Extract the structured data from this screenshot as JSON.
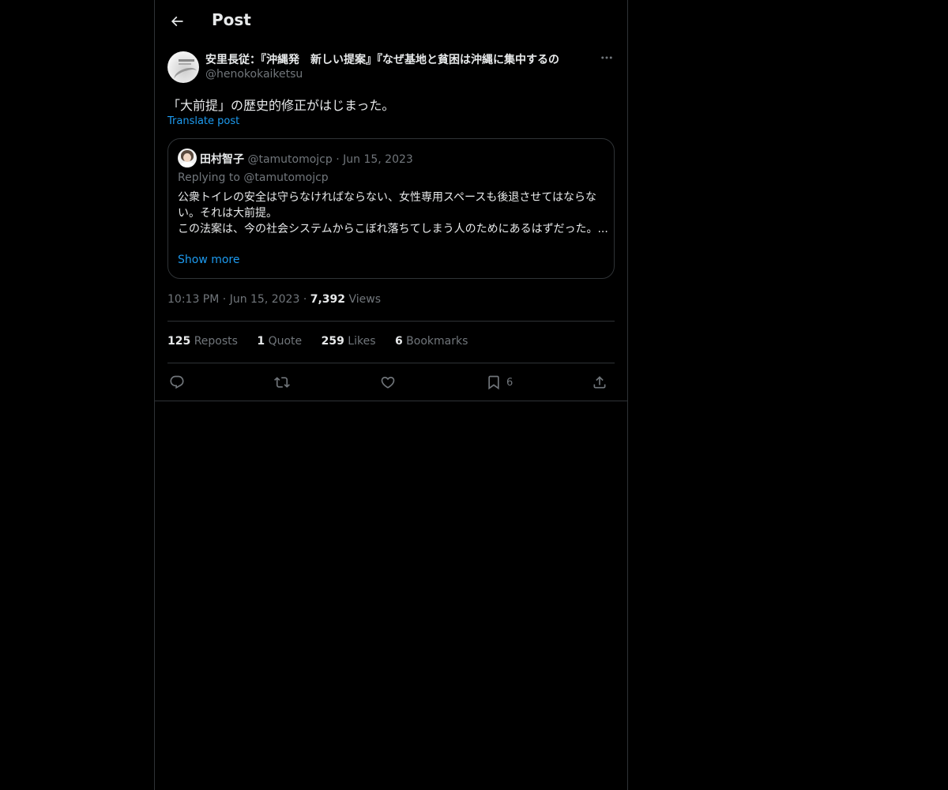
{
  "header": {
    "title": "Post"
  },
  "post": {
    "author": {
      "display_name": "安里長従：『沖縄発　新しい提案』『なぜ基地と貧困は沖縄に集中するの",
      "handle": "@henokokaiketsu"
    },
    "text": "「大前提」の歴史的修正がはじまった。",
    "translate_label": "Translate post",
    "quote": {
      "name": "田村智子",
      "handle": "@tamutomojcp",
      "separator": "·",
      "date": "Jun 15, 2023",
      "replying_to": "Replying to @tamutomojcp",
      "lines": [
        "公衆トイレの安全は守らなければならない、女性専用スペースも後退させてはならない。それは大前提。",
        "この法案は、今の社会システムからこぼれ落ちてしまう人のためにあるはずだった。..."
      ],
      "show_more": "Show more"
    },
    "time": "10:13 PM",
    "separator": "·",
    "date": "Jun 15, 2023",
    "views_count": "7,392",
    "views_label": "Views",
    "stats": {
      "reposts_count": "125",
      "reposts_label": "Reposts",
      "quotes_count": "1",
      "quotes_label": "Quote",
      "likes_count": "259",
      "likes_label": "Likes",
      "bookmarks_count": "6",
      "bookmarks_label": "Bookmarks"
    },
    "actions": {
      "reply_icon": "reply-icon",
      "repost_icon": "repost-icon",
      "like_icon": "heart-icon",
      "bookmark_icon": "bookmark-icon",
      "bookmark_count": "6",
      "share_icon": "share-icon"
    }
  },
  "colors": {
    "background": "#000000",
    "text": "#e7e9ea",
    "muted": "#71767b",
    "accent": "#1d9bf0",
    "border": "#2f3336"
  }
}
